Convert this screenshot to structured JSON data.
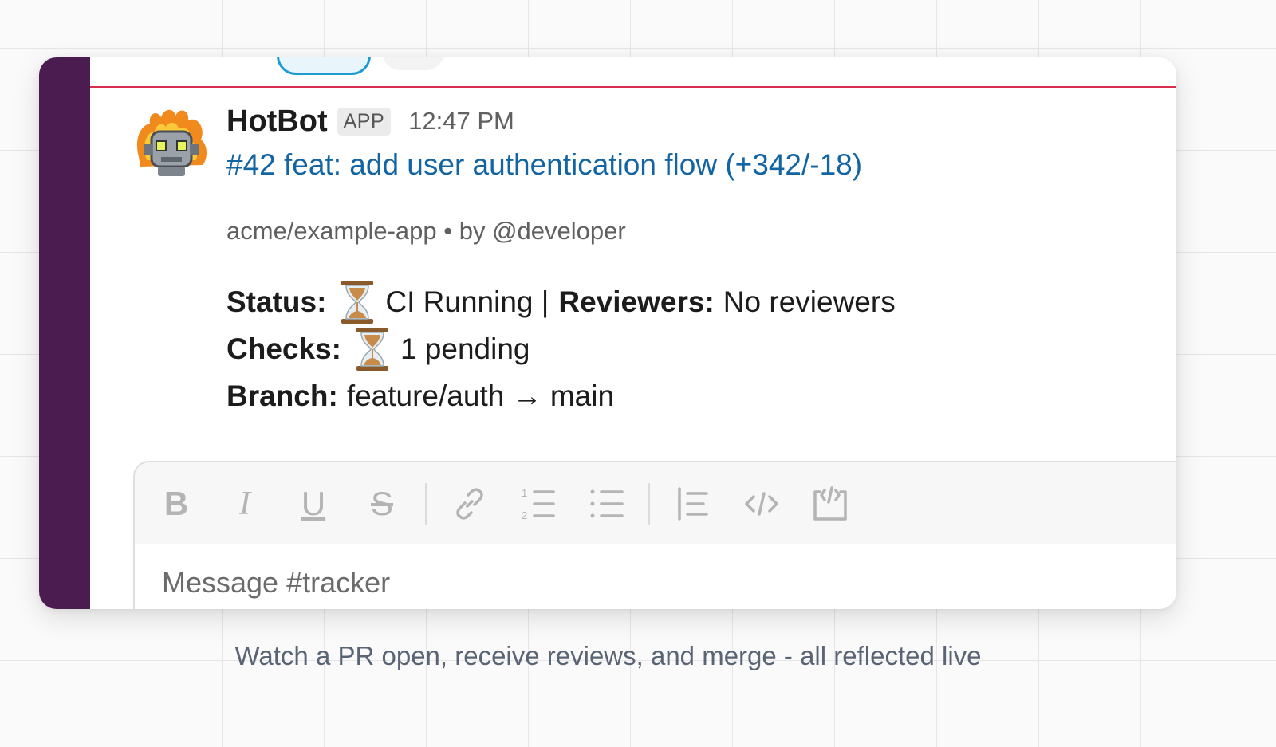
{
  "message": {
    "sender": "HotBot",
    "badge": "APP",
    "time": "12:47 PM",
    "pr_title": "#42 feat: add user authentication flow (+342/-18)",
    "meta": "acme/example-app • by @developer",
    "status_label": "Status:",
    "status_value": "CI Running |",
    "reviewers_label": "Reviewers:",
    "reviewers_value": "No reviewers",
    "checks_label": "Checks:",
    "checks_value": "1 pending",
    "branch_label": "Branch:",
    "branch_value": "feature/auth → main"
  },
  "composer": {
    "placeholder": "Message #tracker",
    "toolbar_icons": [
      "bold-icon",
      "italic-icon",
      "underline-icon",
      "strikethrough-icon",
      "link-icon",
      "ordered-list-icon",
      "bullet-list-icon",
      "blockquote-icon",
      "code-icon",
      "code-block-icon"
    ]
  },
  "caption": "Watch a PR open, receive reviews, and merge - all reflected live",
  "colors": {
    "rail": "#4a1c4f",
    "new_divider": "#d92d4c",
    "link": "#1264a3"
  }
}
